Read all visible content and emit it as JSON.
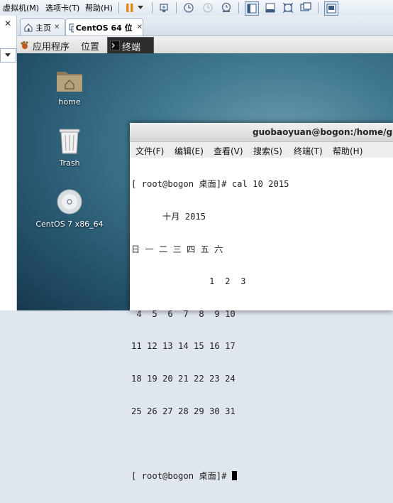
{
  "vmware": {
    "menu": [
      "虚拟机(M)",
      "选项卡(T)",
      "帮助(H)"
    ],
    "toolbar_icons": [
      "pause-icon",
      "dropdown-icon",
      "send-keys-icon",
      "snapshot-icon",
      "revert-snapshot-icon",
      "manage-snapshots-icon",
      "library-view-icon",
      "console-view-icon",
      "fullscreen-icon",
      "unity-icon",
      "thumbnail-icon"
    ]
  },
  "tabs": [
    {
      "label": "主页",
      "icon": "home-icon"
    },
    {
      "label": "CentOS 64 位",
      "icon": "vm-icon"
    }
  ],
  "gnome_panel": {
    "applications": "应用程序",
    "places": "位置",
    "terminal_task": "终端"
  },
  "desktop_icons": [
    {
      "label": "home",
      "icon": "folder-icon"
    },
    {
      "label": "Trash",
      "icon": "trash-icon"
    },
    {
      "label": "CentOS 7 x86_64",
      "icon": "dvd-icon"
    }
  ],
  "terminal": {
    "title": "guobaoyuan@bogon:/home/guob",
    "menu": [
      "文件(F)",
      "编辑(E)",
      "查看(V)",
      "搜索(S)",
      "终端(T)",
      "帮助(H)"
    ],
    "lines": [
      "[ root@bogon 桌面]# cal 10 2015",
      "      十月 2015",
      "日 一 二 三 四 五 六",
      "               1  2  3",
      " 4  5  6  7  8  9 10",
      "11 12 13 14 15 16 17",
      "18 19 20 21 22 23 24",
      "25 26 27 28 29 30 31",
      "",
      "[ root@bogon 桌面]# "
    ]
  }
}
